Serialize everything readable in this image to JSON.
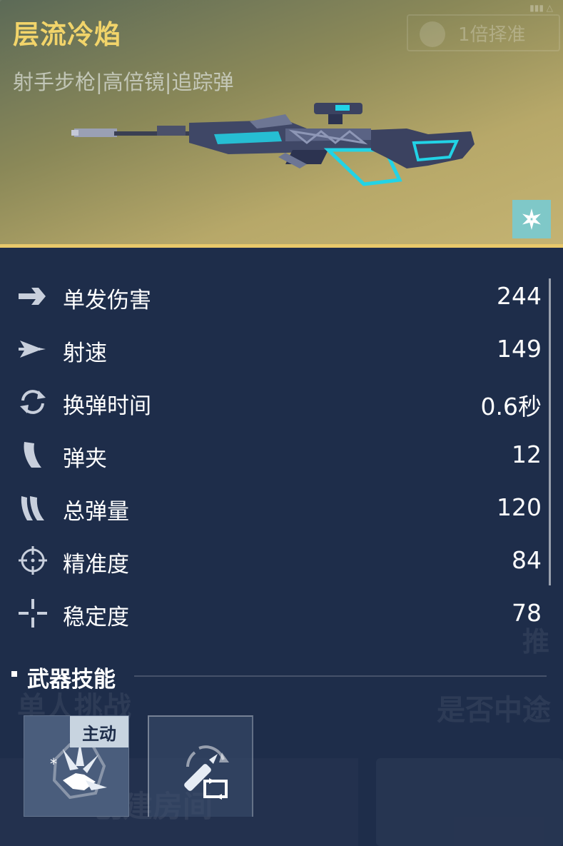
{
  "weapon": {
    "name": "层流冷焰",
    "tags": "射手步枪|高倍镜|追踪弹",
    "element_icon": "snowflake-icon",
    "accent_color": "#f2d46a",
    "element_color": "#7fc8c8"
  },
  "background": {
    "scope_badge": "1倍择准",
    "recommend": "推",
    "challenge": "单人挑战",
    "whether": "是否中途",
    "create_room": "创建房间"
  },
  "stats": [
    {
      "icon": "arrow-right-icon",
      "label": "单发伤害",
      "value": "244"
    },
    {
      "icon": "fire-rate-icon",
      "label": "射速",
      "value": "149"
    },
    {
      "icon": "reload-icon",
      "label": "换弹时间",
      "value": "0.6秒"
    },
    {
      "icon": "magazine-icon",
      "label": "弹夹",
      "value": "12"
    },
    {
      "icon": "ammo-icon",
      "label": "总弹量",
      "value": "120"
    },
    {
      "icon": "crosshair-icon",
      "label": "精准度",
      "value": "84"
    },
    {
      "icon": "stability-icon",
      "label": "稳定度",
      "value": "78"
    }
  ],
  "skills": {
    "title": "武器技能",
    "items": [
      {
        "icon": "ice-crystal-icon",
        "tag": "主动"
      },
      {
        "icon": "tracking-bullet-icon",
        "tag": ""
      }
    ]
  }
}
